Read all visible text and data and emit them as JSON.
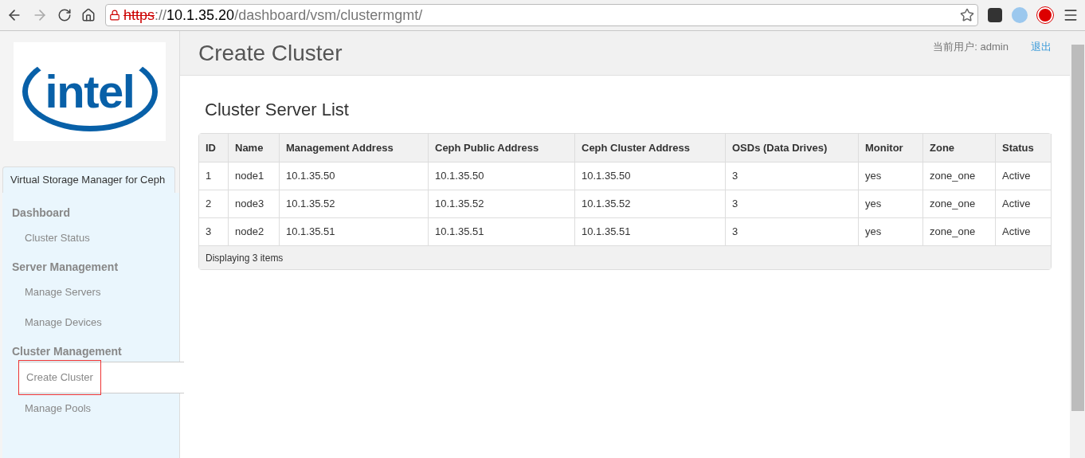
{
  "browser": {
    "url_scheme": "https",
    "url_separator": "://",
    "url_host": "10.1.35.20",
    "url_path": "/dashboard/vsm/clustermgmt/"
  },
  "sidebar": {
    "logo_text": "intel",
    "tab": "Virtual Storage Manager for Ceph",
    "groups": [
      {
        "title": "Dashboard",
        "items": [
          {
            "label": "Cluster Status",
            "selected": false
          }
        ]
      },
      {
        "title": "Server Management",
        "items": [
          {
            "label": "Manage Servers",
            "selected": false
          },
          {
            "label": "Manage Devices",
            "selected": false
          }
        ]
      },
      {
        "title": "Cluster Management",
        "items": [
          {
            "label": "Create Cluster",
            "selected": true
          },
          {
            "label": "Manage Pools",
            "selected": false
          }
        ]
      }
    ]
  },
  "header": {
    "title": "Create Cluster",
    "user": "当前用户: admin",
    "logout": "退出"
  },
  "table": {
    "title": "Cluster Server List",
    "columns": [
      "ID",
      "Name",
      "Management Address",
      "Ceph Public Address",
      "Ceph Cluster Address",
      "OSDs (Data Drives)",
      "Monitor",
      "Zone",
      "Status"
    ],
    "rows": [
      [
        "1",
        "node1",
        "10.1.35.50",
        "10.1.35.50",
        "10.1.35.50",
        "3",
        "yes",
        "zone_one",
        "Active"
      ],
      [
        "2",
        "node3",
        "10.1.35.52",
        "10.1.35.52",
        "10.1.35.52",
        "3",
        "yes",
        "zone_one",
        "Active"
      ],
      [
        "3",
        "node2",
        "10.1.35.51",
        "10.1.35.51",
        "10.1.35.51",
        "3",
        "yes",
        "zone_one",
        "Active"
      ]
    ],
    "footer": "Displaying 3 items"
  }
}
